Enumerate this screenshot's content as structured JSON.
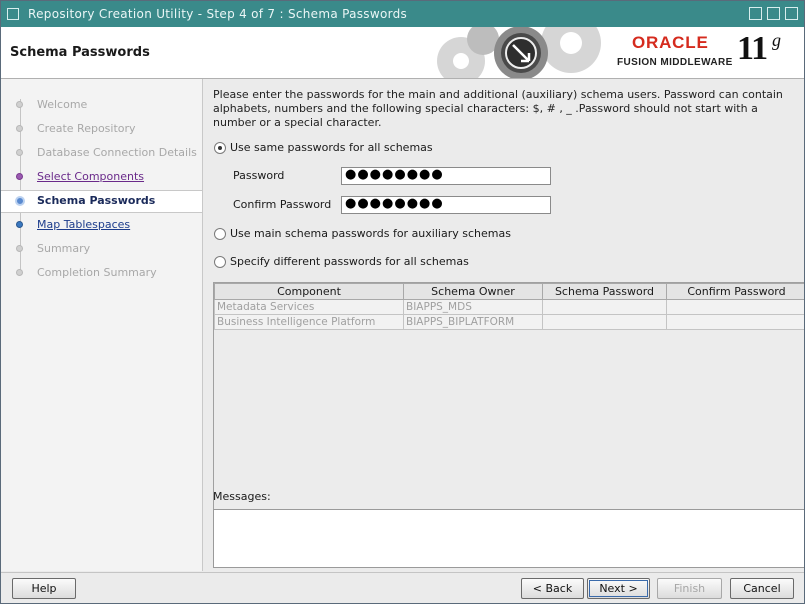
{
  "window": {
    "title": "Repository Creation Utility - Step 4 of 7 : Schema Passwords"
  },
  "header": {
    "title": "Schema Passwords",
    "logo_oracle": "ORACLE",
    "logo_fusion": "FUSION MIDDLEWARE",
    "logo_version": "11",
    "logo_suffix": "g"
  },
  "sidebar": {
    "items": [
      {
        "label": "Welcome",
        "state": "disabled"
      },
      {
        "label": "Create Repository",
        "state": "disabled"
      },
      {
        "label": "Database Connection Details",
        "state": "disabled"
      },
      {
        "label": "Select Components",
        "state": "visited"
      },
      {
        "label": "Schema Passwords",
        "state": "current"
      },
      {
        "label": "Map Tablespaces",
        "state": "link"
      },
      {
        "label": "Summary",
        "state": "disabled"
      },
      {
        "label": "Completion Summary",
        "state": "disabled"
      }
    ]
  },
  "main": {
    "intro": "Please enter the passwords for the main and additional (auxiliary) schema users. Password can contain alphabets, numbers and the following special characters: $, # , _ .Password should not start with a number or a special character.",
    "option_same": "Use same passwords for all schemas",
    "option_main_aux": "Use main schema passwords for auxiliary schemas",
    "option_different": "Specify different passwords for all schemas",
    "password_label": "Password",
    "password_value": "●●●●●●●●",
    "confirm_label": "Confirm Password",
    "confirm_value": "●●●●●●●●",
    "table": {
      "headers": [
        "Component",
        "Schema Owner",
        "Schema Password",
        "Confirm Password"
      ],
      "rows": [
        [
          "Metadata Services",
          "BIAPPS_MDS",
          "",
          ""
        ],
        [
          "Business Intelligence Platform",
          "BIAPPS_BIPLATFORM",
          "",
          ""
        ]
      ]
    },
    "messages_label": "Messages:"
  },
  "footer": {
    "help": "Help",
    "back": "< Back",
    "next": "Next >",
    "finish": "Finish",
    "cancel": "Cancel"
  },
  "colors": {
    "titlebar": "#3a8a8a",
    "oracle_red": "#d52b1e",
    "link": "#1c3c8c",
    "visited": "#6a2a8a"
  }
}
